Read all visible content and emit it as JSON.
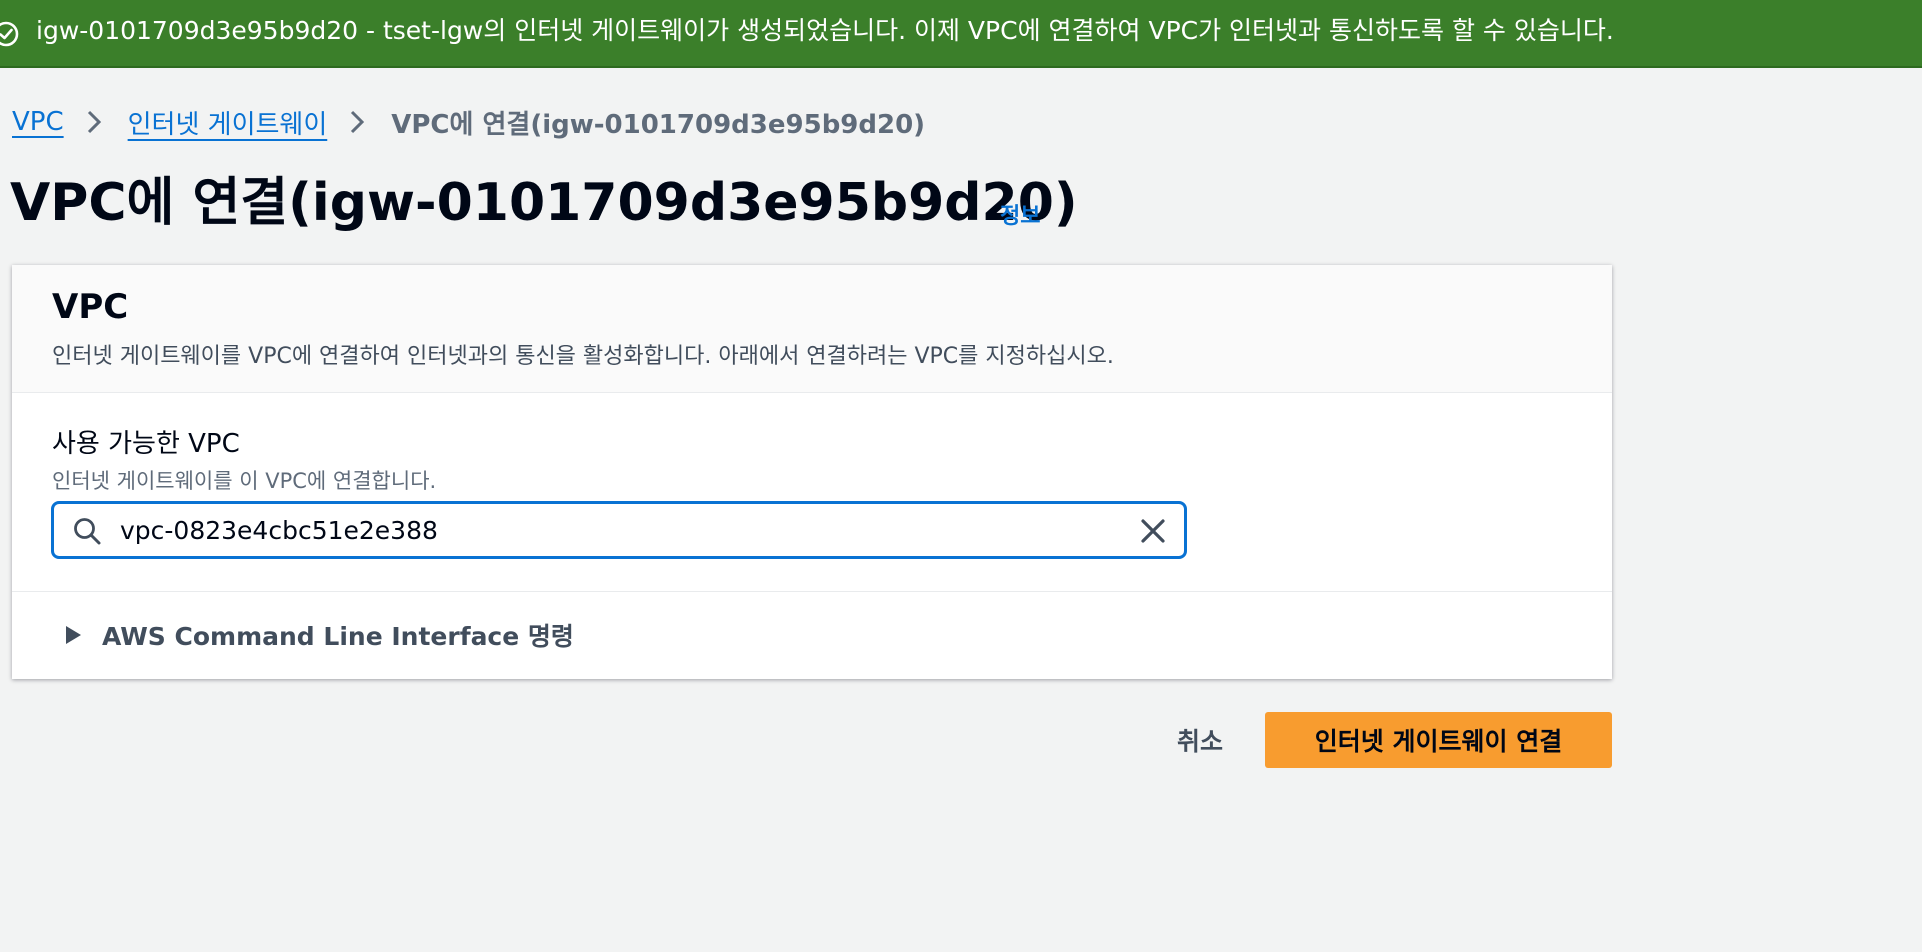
{
  "flash": {
    "icon": "check-circle-icon",
    "message": "igw-0101709d3e95b9d20 - tset-lgw의 인터넷 게이트웨이가 생성되었습니다. 이제 VPC에 연결하여 VPC가 인터넷과 통신하도록 할 수 있습니다.",
    "color": "#3b7f2a"
  },
  "breadcrumb": {
    "items": [
      {
        "label": "VPC"
      },
      {
        "label": "인터넷 게이트웨이"
      },
      {
        "label": "VPC에 연결(igw-0101709d3e95b9d20)"
      }
    ]
  },
  "header": {
    "title": "VPC에 연결(igw-0101709d3e95b9d20)",
    "info_label": "정보"
  },
  "container": {
    "title": "VPC",
    "description": "인터넷 게이트웨이를 VPC에 연결하여 인터넷과의 통신을 활성화합니다. 아래에서 연결하려는 VPC를 지정하십시오.",
    "field": {
      "label": "사용 가능한 VPC",
      "description": "인터넷 게이트웨이를 이 VPC에 연결합니다.",
      "value": "vpc-0823e4cbc51e2e388"
    },
    "expander": {
      "label": "AWS Command Line Interface 명령"
    }
  },
  "actions": {
    "cancel_label": "취소",
    "submit_label": "인터넷 게이트웨이 연결",
    "accent": "#f89c2f"
  }
}
